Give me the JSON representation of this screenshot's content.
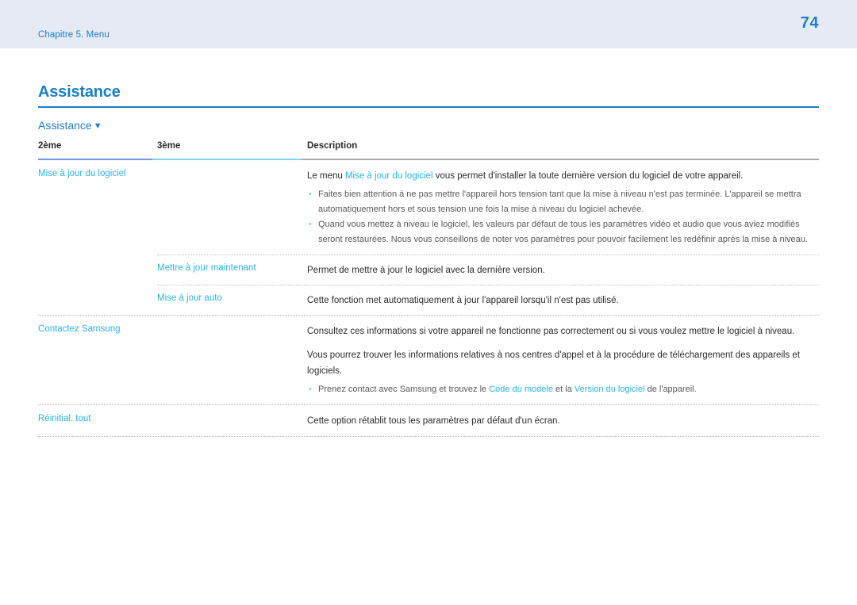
{
  "header": {
    "chapter": "Chapitre 5. Menu",
    "page_number": "74",
    "band_color": "#e6eaf5",
    "accent_color": "#1f7fc4"
  },
  "section": {
    "title": "Assistance",
    "subsection": "Assistance",
    "subsection_marker": "▼",
    "rule_color": "#1a7fc1"
  },
  "table": {
    "headers": {
      "col1": "2ème",
      "col2": "3ème",
      "col3": "Description"
    },
    "rule_segments": {
      "col1_color": "#6f9de0",
      "col2_color": "#7fd3f4",
      "col3_color": "#aaaaaa"
    },
    "term_color": "#29b3e8",
    "rows": [
      {
        "col1": "Mise à jour du logiciel",
        "col2": "",
        "desc_lead_plain": "Le menu ",
        "desc_lead_highlight": "Mise à jour du logiciel",
        "desc_lead_tail": " vous permet d'installer la toute dernière version du logiciel de votre appareil.",
        "bullets": [
          "Faites bien attention à ne pas mettre l'appareil hors tension tant que la mise à niveau n'est pas terminée. L'appareil se mettra automatiquement hors et sous tension une fois la mise à niveau du logiciel achevée.",
          "Quand vous mettez à niveau le logiciel, les valeurs par défaut de tous les paramètres vidéo et audio que vous aviez modifiés seront restaurées. Nous vous conseillons de noter vos paramètres pour pouvoir facilement les redéfinir après la mise à niveau."
        ]
      },
      {
        "col1": "",
        "col2": "Mettre à jour maintenant",
        "desc": "Permet de mettre à jour le logiciel avec la dernière version."
      },
      {
        "col1": "",
        "col2": "Mise à jour auto",
        "desc": "Cette fonction met automatiquement à jour l'appareil lorsqu'il n'est pas utilisé."
      },
      {
        "col1": "Contactez Samsung",
        "col2": "",
        "desc_p1": "Consultez ces informations si votre appareil ne fonctionne pas correctement ou si vous voulez mettre le logiciel à niveau.",
        "desc_p2": "Vous pourrez trouver les informations relatives à nos centres d'appel et à la procédure de téléchargement des appareils et logiciels.",
        "bullet_parts": {
          "p1": "Prenez contact avec Samsung et trouvez le ",
          "hl1": "Code du modèle",
          "p2": " et la ",
          "hl2": "Version du logiciel",
          "p3": " de l'appareil."
        }
      },
      {
        "col1": "Réinitial. tout",
        "col2": "",
        "desc": "Cette option rétablit tous les paramètres par défaut d'un écran."
      }
    ]
  }
}
